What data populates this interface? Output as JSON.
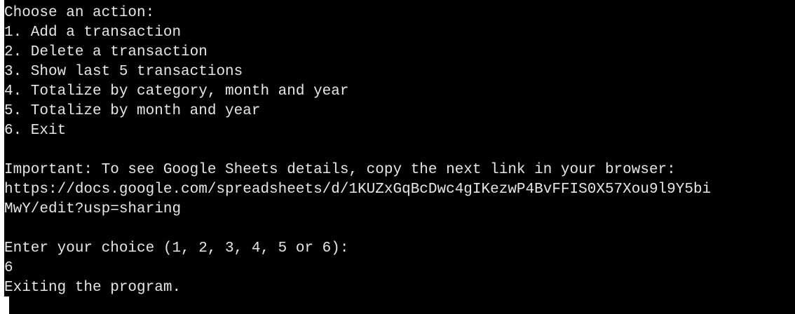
{
  "terminal": {
    "menu_title": "Choose an action:",
    "menu_items": [
      "1. Add a transaction",
      "2. Delete a transaction",
      "3. Show last 5 transactions",
      "4. Totalize by category, month and year",
      "5. Totalize by month and year",
      "6. Exit"
    ],
    "important_line": "Important: To see Google Sheets details, copy the next link in your browser:",
    "link_line_1": "https://docs.google.com/spreadsheets/d/1KUZxGqBcDwc4gIKezwP4BvFFIS0X57Xou9l9Y5bi",
    "link_line_2": "MwY/edit?usp=sharing",
    "prompt": "Enter your choice (1, 2, 3, 4, 5 or 6):",
    "user_input": "6",
    "exit_message": "Exiting the program."
  }
}
